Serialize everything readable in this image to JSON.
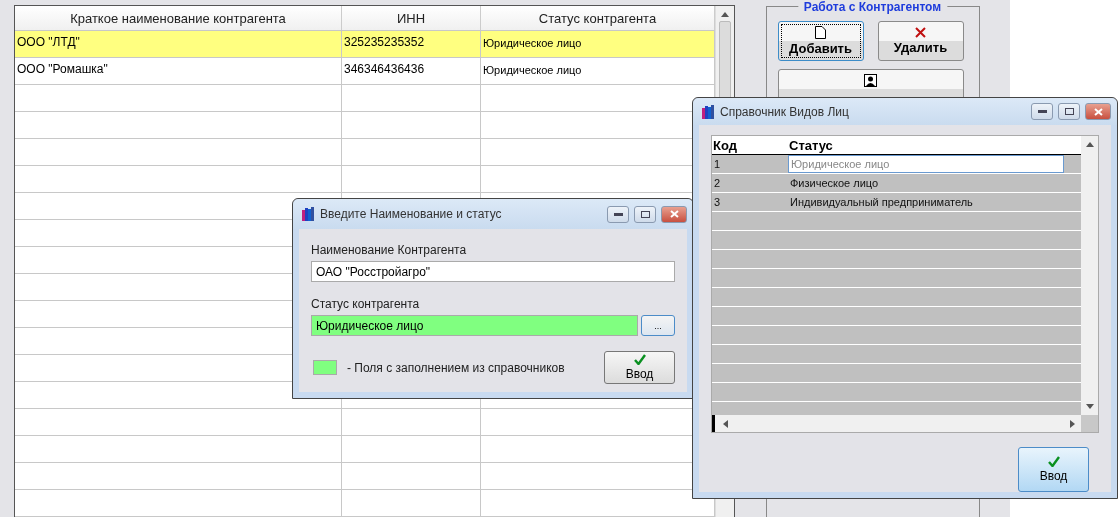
{
  "main_window": {
    "table": {
      "columns": [
        "Краткое наименование контрагента",
        "ИНН",
        "Статус контрагента"
      ],
      "rows": [
        {
          "cells": [
            "ООО \"ЛТД\"",
            "325235235352",
            "Юридическое лицо"
          ],
          "selected": true
        },
        {
          "cells": [
            "ООО \"Ромашка\"",
            "346346436436",
            "Юридическое лицо"
          ],
          "selected": false
        }
      ]
    },
    "panel": {
      "title": "Работа с Контрагентом",
      "buttons": [
        {
          "label": "Добавить",
          "focused": true
        },
        {
          "label": "Удалить",
          "focused": false
        }
      ]
    }
  },
  "name_dialog": {
    "title": "Введите Наименование и статус",
    "fields": [
      {
        "kind": "text",
        "label": "Наименование Контрагента",
        "value": "ОАО \"Росстройагро\""
      },
      {
        "kind": "lookup",
        "label": "Статус контрагента",
        "value": "Юридическое лицо",
        "button": "..."
      }
    ],
    "legend": "-  Поля с заполнением из справочников",
    "ok": "Ввод"
  },
  "types_dialog": {
    "title": "Справочник Видов Лиц",
    "columns": [
      "Код",
      "Статус"
    ],
    "rows": [
      {
        "code": "1",
        "status": "Юридическое лицо",
        "selected": true
      },
      {
        "code": "2",
        "status": "Физическое лицо",
        "selected": false
      },
      {
        "code": "3",
        "status": "Индивидуальный предприниматель",
        "selected": false
      }
    ],
    "ok": "Ввод"
  }
}
